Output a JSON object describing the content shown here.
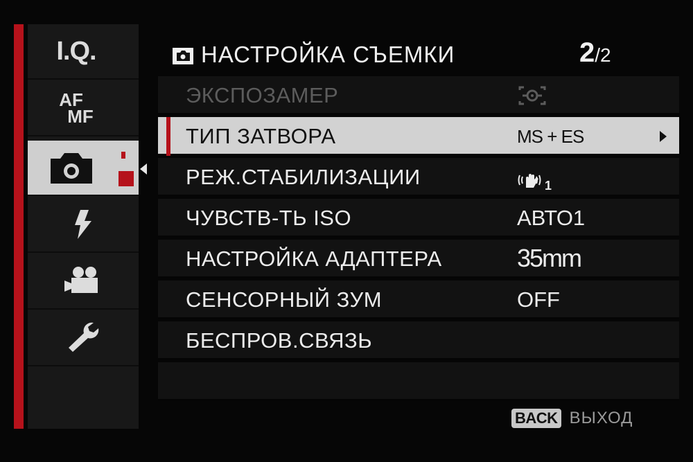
{
  "sidebar": {
    "tabs": [
      {
        "id": "iq",
        "label": "I.Q.",
        "icon": "iq-text"
      },
      {
        "id": "afmf",
        "label_top": "AF",
        "label_bottom": "MF",
        "icon": "af-mf-text"
      },
      {
        "id": "shooting",
        "icon": "camera-icon",
        "selected": true
      },
      {
        "id": "flash",
        "icon": "flash-icon"
      },
      {
        "id": "movie",
        "icon": "movie-camera-icon"
      },
      {
        "id": "setup",
        "icon": "wrench-icon"
      }
    ],
    "accent_color": "#b5121b"
  },
  "header": {
    "title": "НАСТРОЙКА СЪЕМКИ",
    "page_current": "2",
    "page_separator": "/",
    "page_total": "2"
  },
  "menu": {
    "items": [
      {
        "label": "ЭКСПОЗАМЕР",
        "value": "",
        "value_icon": "metering-icon",
        "state": "disabled"
      },
      {
        "label": "ТИП ЗАТВОРА",
        "value": "MS + ES",
        "state": "selected"
      },
      {
        "label": "РЕЖ.СТАБИЛИЗАЦИИ",
        "value": "1",
        "value_icon": "stabilization-hand-icon",
        "state": "normal"
      },
      {
        "label": "ЧУВСТВ-ТЬ ISO",
        "value": "АВТО1",
        "state": "normal"
      },
      {
        "label": "НАСТРОЙКА АДАПТЕРА",
        "value": "35mm",
        "state": "normal"
      },
      {
        "label": "СЕНСОРНЫЙ ЗУМ",
        "value": "OFF",
        "state": "normal"
      },
      {
        "label": "БЕСПРОВ.СВЯЗЬ",
        "value": "",
        "state": "normal"
      },
      {
        "label": "",
        "value": "",
        "state": "empty"
      }
    ]
  },
  "footer": {
    "back_button": "BACK",
    "back_label": "ВЫХОД"
  }
}
